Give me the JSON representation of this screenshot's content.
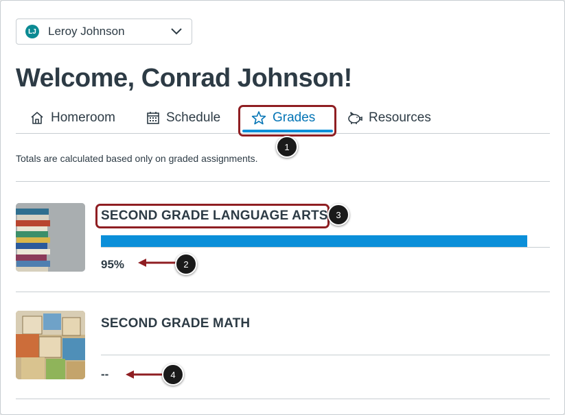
{
  "student_selector": {
    "avatar_initials": "LJ",
    "selected": "Leroy Johnson"
  },
  "page_title": "Welcome, Conrad Johnson!",
  "tabs": [
    {
      "label": "Homeroom",
      "icon": "home-icon"
    },
    {
      "label": "Schedule",
      "icon": "calendar-icon"
    },
    {
      "label": "Grades",
      "icon": "star-icon",
      "active": true
    },
    {
      "label": "Resources",
      "icon": "piggy-bank-icon"
    }
  ],
  "note": "Totals are calculated based only on graded assignments.",
  "courses": [
    {
      "title": "SECOND GRADE LANGUAGE ARTS",
      "grade": "95%",
      "progress": 0.95,
      "thumbnail": "books-image"
    },
    {
      "title": "SECOND GRADE MATH",
      "grade": "--",
      "thumbnail": "blocks-image"
    }
  ],
  "callouts": [
    "1",
    "2",
    "3",
    "4"
  ],
  "colors": {
    "accent": "#0b8fd9",
    "active_tab_text": "#0374b5",
    "callout_border": "#8f1e22",
    "text": "#2d3b45",
    "avatar": "#0b8a93"
  }
}
